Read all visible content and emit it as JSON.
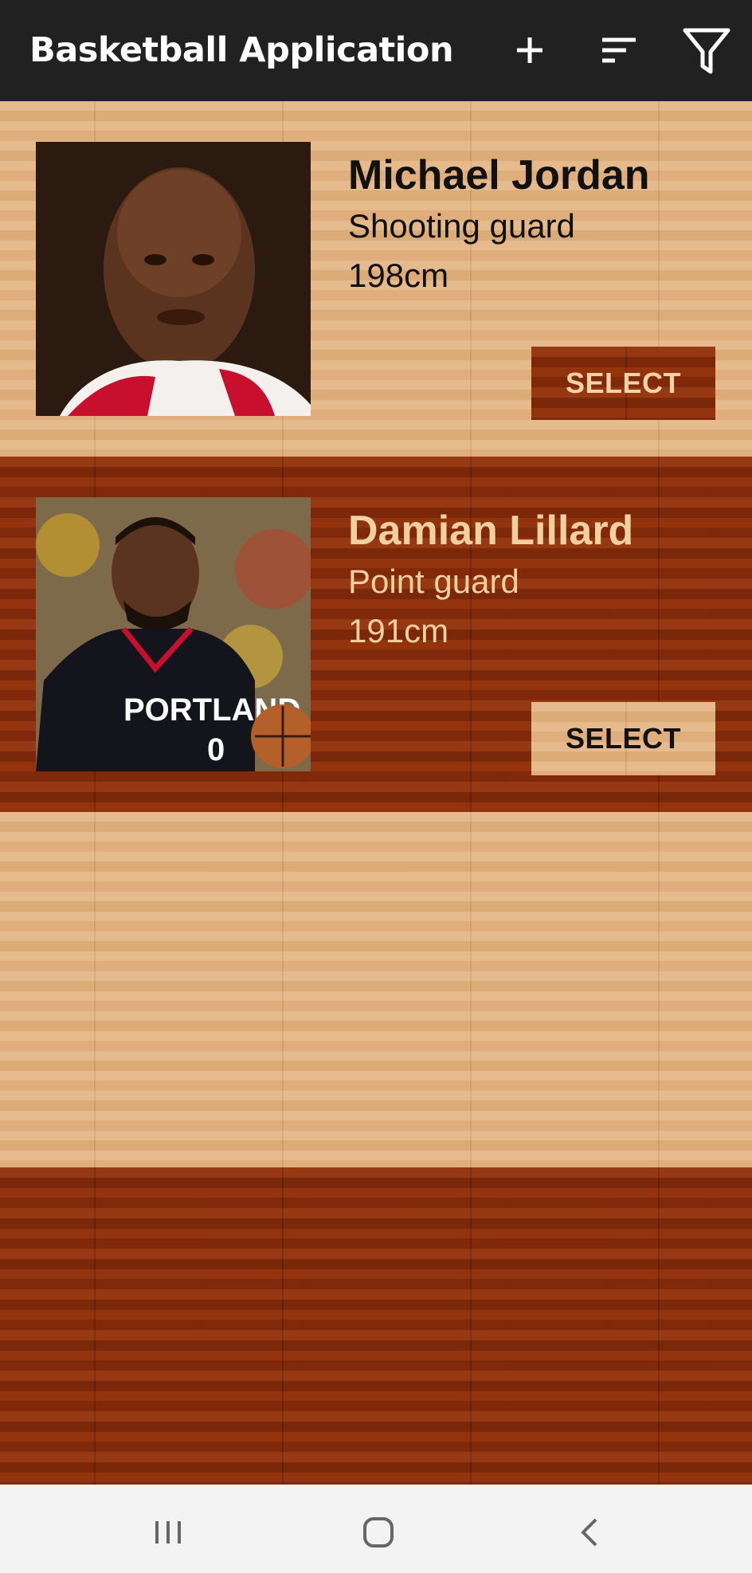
{
  "app_bar": {
    "title": "Basketball Application",
    "icons": [
      "add-icon",
      "sort-icon",
      "filter-icon"
    ]
  },
  "players": [
    {
      "name": "Michael Jordan",
      "position": "Shooting guard",
      "height": "198cm",
      "button_label": "SELECT",
      "jersey_text": ""
    },
    {
      "name": "Damian Lillard",
      "position": "Point guard",
      "height": "191cm",
      "button_label": "SELECT",
      "jersey_text": "PORTLAND",
      "jersey_number": "0"
    }
  ],
  "nav_bar": {
    "icons": [
      "recents-icon",
      "home-icon",
      "back-icon"
    ]
  },
  "colors": {
    "app_bar": "#212121",
    "wood_light": "#e2b381",
    "wood_dark": "#8a2e0c",
    "nav_bar": "#f3f3f3"
  }
}
